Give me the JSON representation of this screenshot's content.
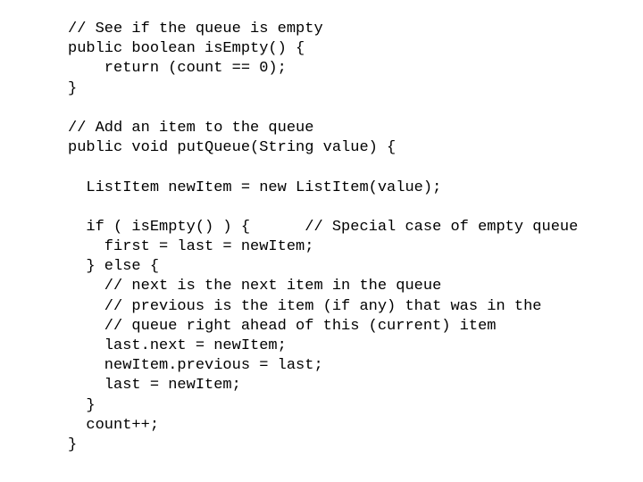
{
  "slide": {
    "background_color": "#ffffff",
    "text_color": "#000000",
    "language": "java",
    "title_visible": false
  },
  "code": {
    "lines": [
      "// See if the queue is empty",
      "public boolean isEmpty() {",
      "    return (count == 0);",
      "}",
      "",
      "// Add an item to the queue",
      "public void putQueue(String value) {",
      "",
      "  ListItem newItem = new ListItem(value);",
      "",
      "  if ( isEmpty() ) {      // Special case of empty queue",
      "    first = last = newItem;",
      "  } else {",
      "    // next is the next item in the queue",
      "    // previous is the item (if any) that was in the",
      "    // queue right ahead of this (current) item",
      "    last.next = newItem;",
      "    newItem.previous = last;",
      "    last = newItem;",
      "  }",
      "  count++;",
      "}"
    ]
  }
}
